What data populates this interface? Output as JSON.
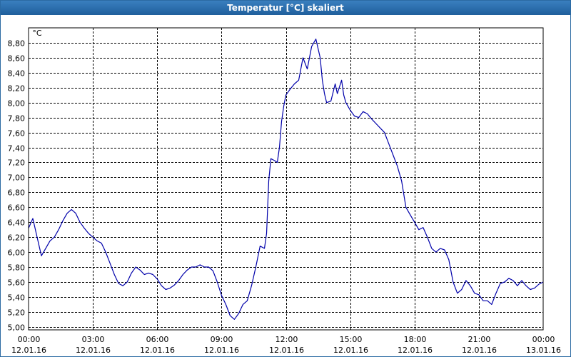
{
  "window": {
    "title": "Temperatur [°C] skaliert"
  },
  "chart_data": {
    "type": "line",
    "title": "Temperatur [°C] skaliert",
    "ylabel": "°C",
    "xlabel": "",
    "grid": true,
    "ylim": [
      4.96,
      9.0
    ],
    "xlim": [
      "2016-01-12 00:00",
      "2016-01-13 00:00"
    ],
    "x_ticks": [
      {
        "x": "2016-01-12 00:00",
        "time": "00:00",
        "date": "12.01.16"
      },
      {
        "x": "2016-01-12 03:00",
        "time": "03:00",
        "date": "12.01.16"
      },
      {
        "x": "2016-01-12 06:00",
        "time": "06:00",
        "date": "12.01.16"
      },
      {
        "x": "2016-01-12 09:00",
        "time": "09:00",
        "date": "12.01.16"
      },
      {
        "x": "2016-01-12 12:00",
        "time": "12:00",
        "date": "12.01.16"
      },
      {
        "x": "2016-01-12 15:00",
        "time": "15:00",
        "date": "12.01.16"
      },
      {
        "x": "2016-01-12 18:00",
        "time": "18:00",
        "date": "12.01.16"
      },
      {
        "x": "2016-01-12 21:00",
        "time": "21:00",
        "date": "12.01.16"
      },
      {
        "x": "2016-01-13 00:00",
        "time": "00:00",
        "date": "13.01.16"
      }
    ],
    "y_ticks": [
      {
        "v": 5.0,
        "label": "5,00"
      },
      {
        "v": 5.2,
        "label": "5,20"
      },
      {
        "v": 5.4,
        "label": "5,40"
      },
      {
        "v": 5.6,
        "label": "5,60"
      },
      {
        "v": 5.8,
        "label": "5,80"
      },
      {
        "v": 6.0,
        "label": "6,00"
      },
      {
        "v": 6.2,
        "label": "6,20"
      },
      {
        "v": 6.4,
        "label": "6,40"
      },
      {
        "v": 6.6,
        "label": "6,60"
      },
      {
        "v": 6.8,
        "label": "6,80"
      },
      {
        "v": 7.0,
        "label": "7,00"
      },
      {
        "v": 7.2,
        "label": "7,20"
      },
      {
        "v": 7.4,
        "label": "7,40"
      },
      {
        "v": 7.6,
        "label": "7,60"
      },
      {
        "v": 7.8,
        "label": "7,80"
      },
      {
        "v": 8.0,
        "label": "8,00"
      },
      {
        "v": 8.2,
        "label": "8,20"
      },
      {
        "v": 8.4,
        "label": "8,40"
      },
      {
        "v": 8.6,
        "label": "8,60"
      },
      {
        "v": 8.8,
        "label": "8,80"
      }
    ],
    "series": [
      {
        "color": "#0000aa",
        "points": [
          [
            "2016-01-12 00:00",
            6.32
          ],
          [
            "2016-01-12 00:12",
            6.45
          ],
          [
            "2016-01-12 00:24",
            6.2
          ],
          [
            "2016-01-12 00:36",
            5.95
          ],
          [
            "2016-01-12 00:48",
            6.05
          ],
          [
            "2016-01-12 01:00",
            6.15
          ],
          [
            "2016-01-12 01:12",
            6.2
          ],
          [
            "2016-01-12 01:24",
            6.3
          ],
          [
            "2016-01-12 01:36",
            6.42
          ],
          [
            "2016-01-12 01:48",
            6.52
          ],
          [
            "2016-01-12 02:00",
            6.57
          ],
          [
            "2016-01-12 02:12",
            6.52
          ],
          [
            "2016-01-12 02:24",
            6.4
          ],
          [
            "2016-01-12 02:36",
            6.32
          ],
          [
            "2016-01-12 02:48",
            6.25
          ],
          [
            "2016-01-12 03:00",
            6.2
          ],
          [
            "2016-01-12 03:12",
            6.15
          ],
          [
            "2016-01-12 03:24",
            6.12
          ],
          [
            "2016-01-12 03:36",
            6.0
          ],
          [
            "2016-01-12 03:48",
            5.85
          ],
          [
            "2016-01-12 04:00",
            5.7
          ],
          [
            "2016-01-12 04:12",
            5.58
          ],
          [
            "2016-01-12 04:24",
            5.55
          ],
          [
            "2016-01-12 04:36",
            5.6
          ],
          [
            "2016-01-12 04:48",
            5.72
          ],
          [
            "2016-01-12 05:00",
            5.8
          ],
          [
            "2016-01-12 05:12",
            5.76
          ],
          [
            "2016-01-12 05:24",
            5.7
          ],
          [
            "2016-01-12 05:36",
            5.72
          ],
          [
            "2016-01-12 05:48",
            5.7
          ],
          [
            "2016-01-12 06:00",
            5.64
          ],
          [
            "2016-01-12 06:12",
            5.55
          ],
          [
            "2016-01-12 06:24",
            5.5
          ],
          [
            "2016-01-12 06:36",
            5.52
          ],
          [
            "2016-01-12 06:48",
            5.56
          ],
          [
            "2016-01-12 07:00",
            5.62
          ],
          [
            "2016-01-12 07:12",
            5.7
          ],
          [
            "2016-01-12 07:24",
            5.76
          ],
          [
            "2016-01-12 07:36",
            5.8
          ],
          [
            "2016-01-12 07:48",
            5.8
          ],
          [
            "2016-01-12 08:00",
            5.83
          ],
          [
            "2016-01-12 08:12",
            5.8
          ],
          [
            "2016-01-12 08:24",
            5.8
          ],
          [
            "2016-01-12 08:36",
            5.75
          ],
          [
            "2016-01-12 08:48",
            5.6
          ],
          [
            "2016-01-12 09:00",
            5.42
          ],
          [
            "2016-01-12 09:12",
            5.3
          ],
          [
            "2016-01-12 09:24",
            5.15
          ],
          [
            "2016-01-12 09:36",
            5.1
          ],
          [
            "2016-01-12 09:48",
            5.18
          ],
          [
            "2016-01-12 10:00",
            5.3
          ],
          [
            "2016-01-12 10:12",
            5.35
          ],
          [
            "2016-01-12 10:24",
            5.55
          ],
          [
            "2016-01-12 10:36",
            5.8
          ],
          [
            "2016-01-12 10:48",
            6.08
          ],
          [
            "2016-01-12 11:00",
            6.05
          ],
          [
            "2016-01-12 11:06",
            6.25
          ],
          [
            "2016-01-12 11:12",
            6.95
          ],
          [
            "2016-01-12 11:18",
            7.25
          ],
          [
            "2016-01-12 11:30",
            7.22
          ],
          [
            "2016-01-12 11:36",
            7.2
          ],
          [
            "2016-01-12 11:42",
            7.4
          ],
          [
            "2016-01-12 11:48",
            7.75
          ],
          [
            "2016-01-12 11:54",
            7.95
          ],
          [
            "2016-01-12 12:00",
            8.1
          ],
          [
            "2016-01-12 12:12",
            8.18
          ],
          [
            "2016-01-12 12:24",
            8.25
          ],
          [
            "2016-01-12 12:36",
            8.3
          ],
          [
            "2016-01-12 12:48",
            8.6
          ],
          [
            "2016-01-12 13:00",
            8.45
          ],
          [
            "2016-01-12 13:12",
            8.75
          ],
          [
            "2016-01-12 13:24",
            8.85
          ],
          [
            "2016-01-12 13:36",
            8.6
          ],
          [
            "2016-01-12 13:42",
            8.3
          ],
          [
            "2016-01-12 13:48",
            8.12
          ],
          [
            "2016-01-12 13:54",
            8.0
          ],
          [
            "2016-01-12 14:06",
            8.02
          ],
          [
            "2016-01-12 14:18",
            8.25
          ],
          [
            "2016-01-12 14:24",
            8.12
          ],
          [
            "2016-01-12 14:36",
            8.3
          ],
          [
            "2016-01-12 14:42",
            8.1
          ],
          [
            "2016-01-12 14:48",
            8.0
          ],
          [
            "2016-01-12 15:00",
            7.9
          ],
          [
            "2016-01-12 15:12",
            7.82
          ],
          [
            "2016-01-12 15:24",
            7.8
          ],
          [
            "2016-01-12 15:36",
            7.88
          ],
          [
            "2016-01-12 15:48",
            7.85
          ],
          [
            "2016-01-12 16:00",
            7.78
          ],
          [
            "2016-01-12 16:12",
            7.72
          ],
          [
            "2016-01-12 16:24",
            7.66
          ],
          [
            "2016-01-12 16:36",
            7.6
          ],
          [
            "2016-01-12 16:48",
            7.45
          ],
          [
            "2016-01-12 17:00",
            7.3
          ],
          [
            "2016-01-12 17:12",
            7.15
          ],
          [
            "2016-01-12 17:24",
            6.95
          ],
          [
            "2016-01-12 17:36",
            6.6
          ],
          [
            "2016-01-12 17:48",
            6.5
          ],
          [
            "2016-01-12 18:00",
            6.4
          ],
          [
            "2016-01-12 18:12",
            6.3
          ],
          [
            "2016-01-12 18:24",
            6.33
          ],
          [
            "2016-01-12 18:36",
            6.2
          ],
          [
            "2016-01-12 18:48",
            6.05
          ],
          [
            "2016-01-12 19:00",
            6.0
          ],
          [
            "2016-01-12 19:12",
            6.05
          ],
          [
            "2016-01-12 19:24",
            6.03
          ],
          [
            "2016-01-12 19:36",
            5.9
          ],
          [
            "2016-01-12 19:48",
            5.6
          ],
          [
            "2016-01-12 20:00",
            5.45
          ],
          [
            "2016-01-12 20:12",
            5.5
          ],
          [
            "2016-01-12 20:24",
            5.62
          ],
          [
            "2016-01-12 20:36",
            5.55
          ],
          [
            "2016-01-12 20:48",
            5.45
          ],
          [
            "2016-01-12 21:00",
            5.43
          ],
          [
            "2016-01-12 21:12",
            5.35
          ],
          [
            "2016-01-12 21:24",
            5.35
          ],
          [
            "2016-01-12 21:36",
            5.3
          ],
          [
            "2016-01-12 21:48",
            5.45
          ],
          [
            "2016-01-12 22:00",
            5.58
          ],
          [
            "2016-01-12 22:12",
            5.6
          ],
          [
            "2016-01-12 22:24",
            5.65
          ],
          [
            "2016-01-12 22:36",
            5.62
          ],
          [
            "2016-01-12 22:48",
            5.55
          ],
          [
            "2016-01-12 23:00",
            5.62
          ],
          [
            "2016-01-12 23:12",
            5.55
          ],
          [
            "2016-01-12 23:24",
            5.5
          ],
          [
            "2016-01-12 23:36",
            5.52
          ],
          [
            "2016-01-12 23:48",
            5.57
          ],
          [
            "2016-01-13 00:00",
            5.6
          ]
        ]
      }
    ]
  }
}
